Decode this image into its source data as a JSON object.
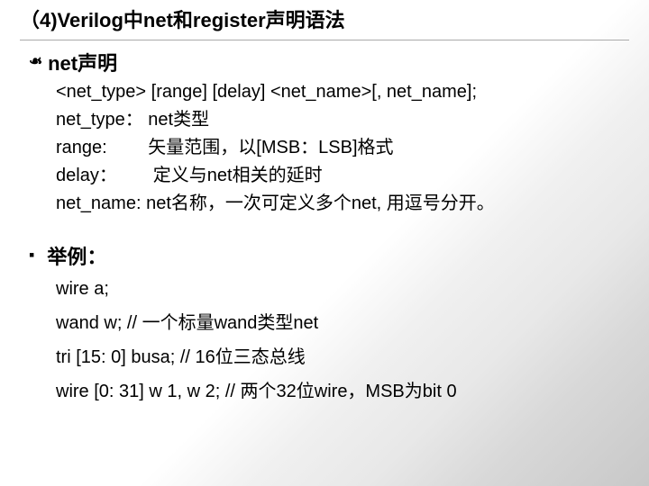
{
  "title": "（4)Verilog中net和register声明语法",
  "net_section": {
    "heading": "net声明",
    "syntax": "<net_type> [range] [delay] <net_name>[, net_name];",
    "lines": [
      "net_type： net类型",
      "range:   矢量范围，以[MSB：LSB]格式",
      "delay：  定义与net相关的延时",
      "net_name:  net名称，一次可定义多个net, 用逗号分开。"
    ]
  },
  "example_section": {
    "heading": "举例：",
    "lines": [
      "wire a;",
      "wand  w; // 一个标量wand类型net",
      "tri [15: 0] busa; // 16位三态总线",
      "wire [0: 31] w 1, w 2; // 两个32位wire，MSB为bit 0"
    ]
  }
}
